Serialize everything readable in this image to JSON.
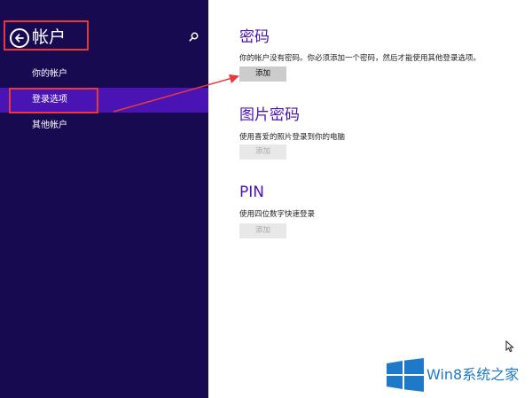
{
  "sidebar": {
    "title": "帐户",
    "items": [
      {
        "label": "你的帐户"
      },
      {
        "label": "登录选项"
      },
      {
        "label": "其他帐户"
      }
    ]
  },
  "main": {
    "sections": [
      {
        "title": "密码",
        "description": "你的帐户没有密码。你必须添加一个密码，然后才能使用其他登录选项。",
        "button": "添加"
      },
      {
        "title": "图片密码",
        "description": "使用喜爱的照片登录到你的电脑",
        "button": "添加"
      },
      {
        "title": "PIN",
        "description": "使用四位数字快速登录",
        "button": "添加"
      }
    ]
  },
  "watermark": {
    "text": "Win8系统之家"
  },
  "colors": {
    "sidebar_bg": "#180a50",
    "sidebar_active": "#4a14b4",
    "accent": "#4a14b4",
    "highlight": "#e8383c"
  }
}
